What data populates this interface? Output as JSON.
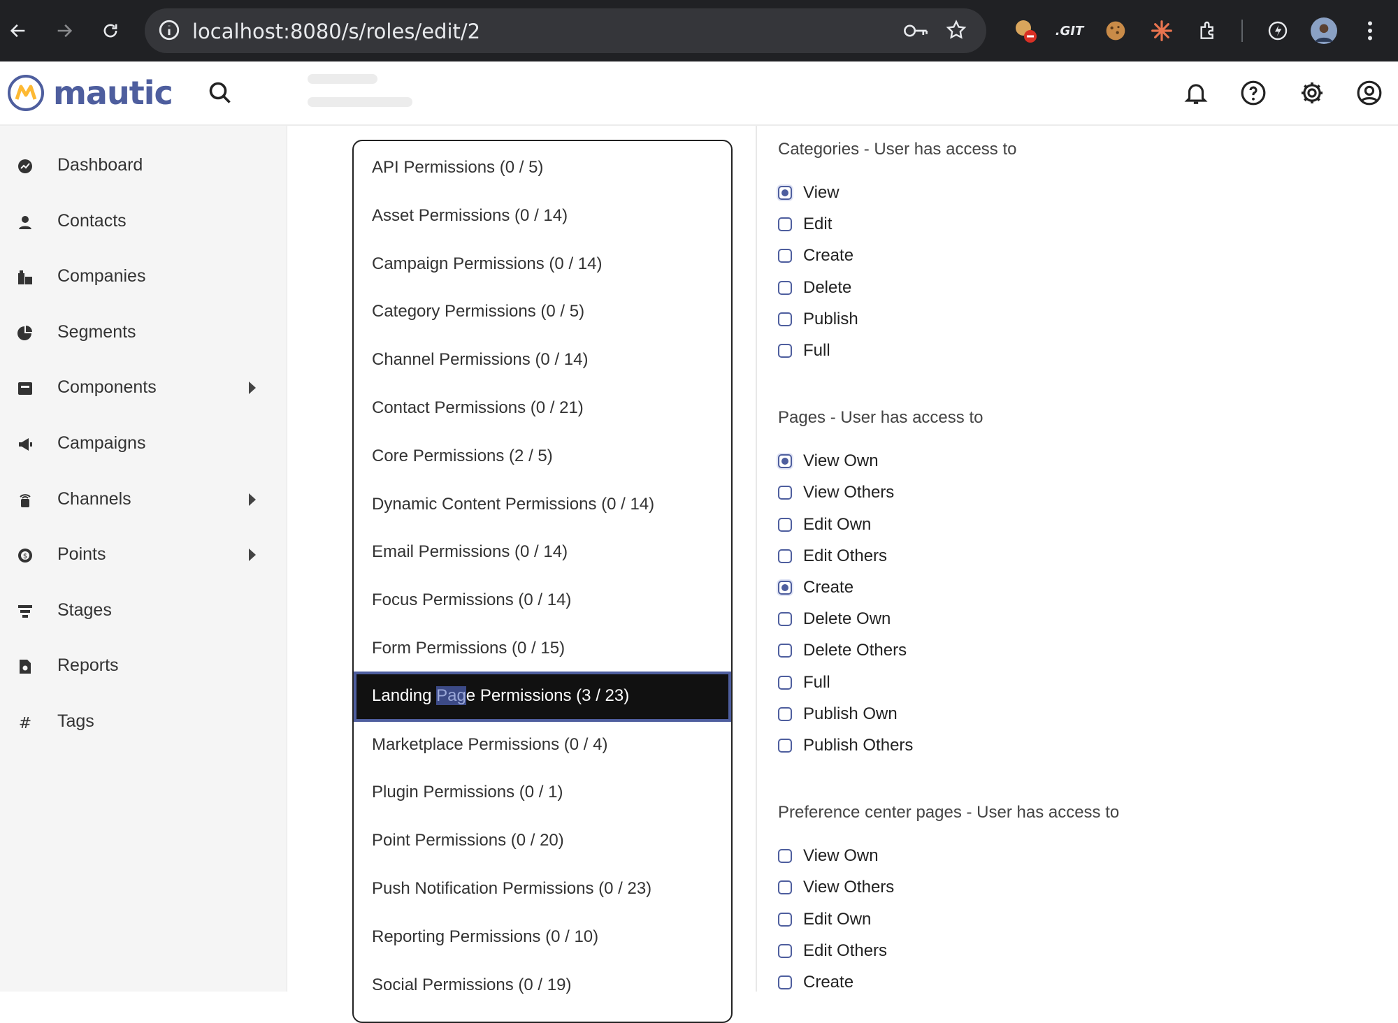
{
  "browser": {
    "url": "localhost:8080/s/roles/edit/2"
  },
  "app": {
    "logo_text": "mautic"
  },
  "sidebar": {
    "items": [
      {
        "label": "Dashboard",
        "icon": "dashboard-icon",
        "has_submenu": false
      },
      {
        "label": "Contacts",
        "icon": "contacts-icon",
        "has_submenu": false
      },
      {
        "label": "Companies",
        "icon": "companies-icon",
        "has_submenu": false
      },
      {
        "label": "Segments",
        "icon": "segments-icon",
        "has_submenu": false
      },
      {
        "label": "Components",
        "icon": "components-icon",
        "has_submenu": true
      },
      {
        "label": "Campaigns",
        "icon": "campaigns-icon",
        "has_submenu": false
      },
      {
        "label": "Channels",
        "icon": "channels-icon",
        "has_submenu": true
      },
      {
        "label": "Points",
        "icon": "points-icon",
        "has_submenu": true
      },
      {
        "label": "Stages",
        "icon": "stages-icon",
        "has_submenu": false
      },
      {
        "label": "Reports",
        "icon": "reports-icon",
        "has_submenu": false
      },
      {
        "label": "Tags",
        "icon": "tags-icon",
        "has_submenu": false
      }
    ]
  },
  "permission_list": {
    "items": [
      {
        "label": "API Permissions (0 / 5)"
      },
      {
        "label": "Asset Permissions (0 / 14)"
      },
      {
        "label": "Campaign Permissions (0 / 14)"
      },
      {
        "label": "Category Permissions (0 / 5)"
      },
      {
        "label": "Channel Permissions (0 / 14)"
      },
      {
        "label": "Contact Permissions (0 / 21)"
      },
      {
        "label": "Core Permissions (2 / 5)"
      },
      {
        "label": "Dynamic Content Permissions (0 / 14)"
      },
      {
        "label": "Email Permissions (0 / 14)"
      },
      {
        "label": "Focus Permissions (0 / 14)"
      },
      {
        "label": "Form Permissions (0 / 15)"
      },
      {
        "label": "Landing Page Permissions (3 / 23)",
        "active": true,
        "parts": [
          "Landing ",
          "Pag",
          "e Permissions (3 / 23)"
        ]
      },
      {
        "label": "Marketplace Permissions (0 / 4)"
      },
      {
        "label": "Plugin Permissions (0 / 1)"
      },
      {
        "label": "Point Permissions (0 / 20)"
      },
      {
        "label": "Push Notification Permissions (0 / 23)"
      },
      {
        "label": "Reporting Permissions (0 / 10)"
      },
      {
        "label": "Social Permissions (0 / 19)"
      }
    ]
  },
  "permission_panel": {
    "sections": [
      {
        "title": "Categories - User has access to",
        "options": [
          {
            "label": "View",
            "checked": true
          },
          {
            "label": "Edit",
            "checked": false
          },
          {
            "label": "Create",
            "checked": false
          },
          {
            "label": "Delete",
            "checked": false
          },
          {
            "label": "Publish",
            "checked": false
          },
          {
            "label": "Full",
            "checked": false
          }
        ]
      },
      {
        "title": "Pages - User has access to",
        "options": [
          {
            "label": "View Own",
            "checked": true
          },
          {
            "label": "View Others",
            "checked": false
          },
          {
            "label": "Edit Own",
            "checked": false
          },
          {
            "label": "Edit Others",
            "checked": false
          },
          {
            "label": "Create",
            "checked": true
          },
          {
            "label": "Delete Own",
            "checked": false
          },
          {
            "label": "Delete Others",
            "checked": false
          },
          {
            "label": "Full",
            "checked": false
          },
          {
            "label": "Publish Own",
            "checked": false
          },
          {
            "label": "Publish Others",
            "checked": false
          }
        ]
      },
      {
        "title": "Preference center pages - User has access to",
        "options": [
          {
            "label": "View Own",
            "checked": false
          },
          {
            "label": "View Others",
            "checked": false
          },
          {
            "label": "Edit Own",
            "checked": false
          },
          {
            "label": "Edit Others",
            "checked": false
          },
          {
            "label": "Create",
            "checked": false
          }
        ]
      }
    ]
  },
  "colors": {
    "accent": "#4e5e9e",
    "active_item_bg": "#111111",
    "selection_highlight": "#3c4a86"
  }
}
